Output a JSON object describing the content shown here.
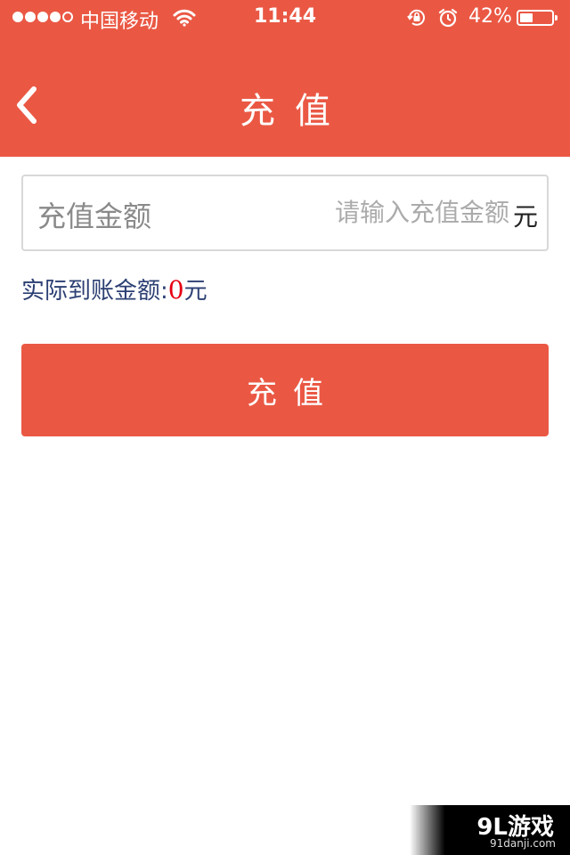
{
  "status_bar": {
    "carrier": "中国移动",
    "time": "11:44",
    "battery_percent": "42%",
    "battery_level": 0.42,
    "signal_bars": 4,
    "signal_total": 5,
    "icons": [
      "wifi-icon",
      "rotation-lock-icon",
      "alarm-icon",
      "battery-icon"
    ]
  },
  "nav": {
    "title": "充值",
    "back_icon": "chevron-left-icon"
  },
  "form": {
    "amount_label": "充值金额",
    "amount_placeholder": "请输入充值金额",
    "amount_value": "",
    "amount_unit": "元",
    "actual_label": "实际到账金额:",
    "actual_value": "0",
    "actual_unit": "元",
    "submit_label": "充值"
  },
  "watermark": {
    "logo": "9L游戏",
    "url": "91danji.com"
  },
  "colors": {
    "primary": "#ea5844",
    "label_blue": "#2c3f73",
    "value_red": "#e60012"
  }
}
